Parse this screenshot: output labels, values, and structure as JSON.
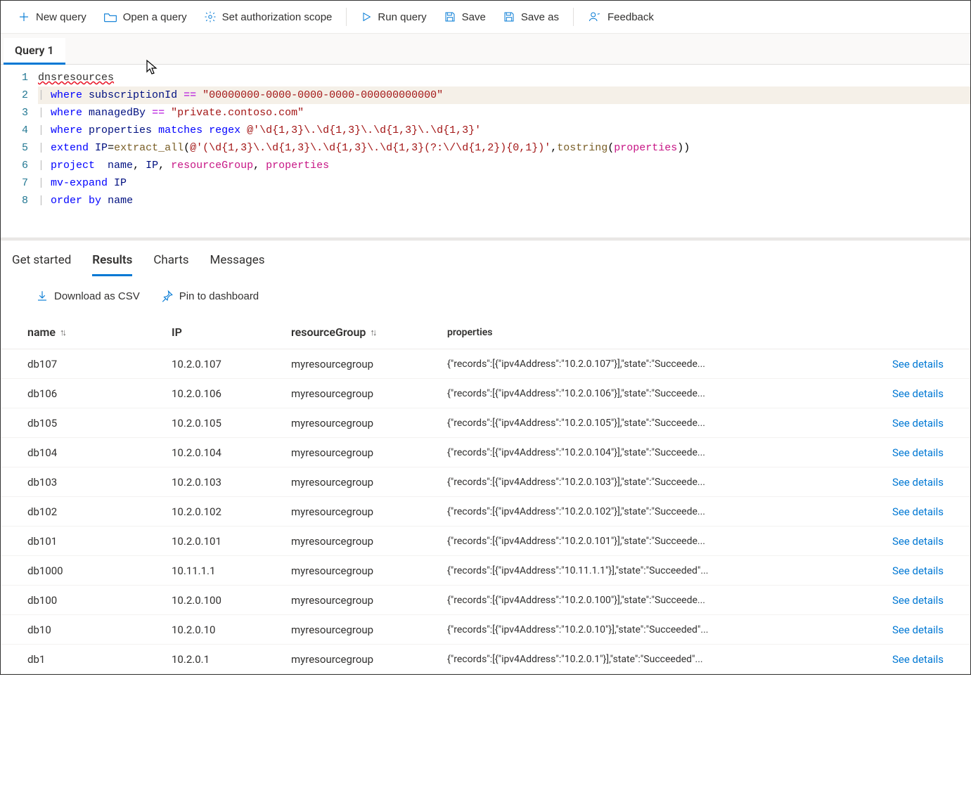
{
  "toolbar": {
    "new_query": "New query",
    "open_query": "Open a query",
    "set_scope": "Set authorization scope",
    "run_query": "Run query",
    "save": "Save",
    "save_as": "Save as",
    "feedback": "Feedback"
  },
  "tabs": {
    "active": "Query 1"
  },
  "editor": {
    "lines": [
      {
        "n": 1,
        "tokens": [
          {
            "t": "table",
            "v": "dnsresources"
          }
        ]
      },
      {
        "n": 2,
        "hl": true,
        "tokens": [
          {
            "t": "pipe",
            "v": "| "
          },
          {
            "t": "kw",
            "v": "where "
          },
          {
            "t": "col",
            "v": "subscriptionId "
          },
          {
            "t": "op",
            "v": "== "
          },
          {
            "t": "str",
            "v": "\"00000000-0000-0000-0000-000000000000\""
          }
        ]
      },
      {
        "n": 3,
        "tokens": [
          {
            "t": "pipe",
            "v": "| "
          },
          {
            "t": "kw",
            "v": "where "
          },
          {
            "t": "col",
            "v": "managedBy "
          },
          {
            "t": "op",
            "v": "== "
          },
          {
            "t": "str",
            "v": "\"private.contoso.com\""
          }
        ]
      },
      {
        "n": 4,
        "tokens": [
          {
            "t": "pipe",
            "v": "| "
          },
          {
            "t": "kw",
            "v": "where "
          },
          {
            "t": "col",
            "v": "properties "
          },
          {
            "t": "kw",
            "v": "matches regex "
          },
          {
            "t": "re",
            "v": "@'\\d{1,3}\\.\\d{1,3}\\.\\d{1,3}\\.\\d{1,3}'"
          }
        ]
      },
      {
        "n": 5,
        "tokens": [
          {
            "t": "pipe",
            "v": "| "
          },
          {
            "t": "kw",
            "v": "extend "
          },
          {
            "t": "col",
            "v": "IP"
          },
          {
            "t": "punc",
            "v": "="
          },
          {
            "t": "func",
            "v": "extract_all"
          },
          {
            "t": "punc",
            "v": "("
          },
          {
            "t": "re",
            "v": "@'(\\d{1,3}\\.\\d{1,3}\\.\\d{1,3}\\.\\d{1,3}(?:\\/\\d{1,2}){0,1})'"
          },
          {
            "t": "punc",
            "v": ","
          },
          {
            "t": "func",
            "v": "tostring"
          },
          {
            "t": "punc",
            "v": "("
          },
          {
            "t": "col2",
            "v": "properties"
          },
          {
            "t": "punc",
            "v": "))"
          }
        ]
      },
      {
        "n": 6,
        "tokens": [
          {
            "t": "pipe",
            "v": "| "
          },
          {
            "t": "kw",
            "v": "project  "
          },
          {
            "t": "col",
            "v": "name"
          },
          {
            "t": "punc",
            "v": ", "
          },
          {
            "t": "col",
            "v": "IP"
          },
          {
            "t": "punc",
            "v": ", "
          },
          {
            "t": "col2",
            "v": "resourceGroup"
          },
          {
            "t": "punc",
            "v": ", "
          },
          {
            "t": "col2",
            "v": "properties"
          }
        ]
      },
      {
        "n": 7,
        "tokens": [
          {
            "t": "pipe",
            "v": "| "
          },
          {
            "t": "kw",
            "v": "mv-expand "
          },
          {
            "t": "col",
            "v": "IP"
          }
        ]
      },
      {
        "n": 8,
        "tokens": [
          {
            "t": "pipe",
            "v": "| "
          },
          {
            "t": "kw",
            "v": "order "
          },
          {
            "t": "opblk",
            "v": "by "
          },
          {
            "t": "col",
            "v": "name"
          }
        ]
      }
    ]
  },
  "result_tabs": {
    "get_started": "Get started",
    "results": "Results",
    "charts": "Charts",
    "messages": "Messages"
  },
  "result_actions": {
    "download_csv": "Download as CSV",
    "pin_dashboard": "Pin to dashboard"
  },
  "table": {
    "headers": {
      "name": "name",
      "ip": "IP",
      "rg": "resourceGroup",
      "props": "properties"
    },
    "see_details": "See details",
    "rows": [
      {
        "name": "db107",
        "ip": "10.2.0.107",
        "rg": "myresourcegroup",
        "props": "{\"records\":[{\"ipv4Address\":\"10.2.0.107\"}],\"state\":\"Succeede..."
      },
      {
        "name": "db106",
        "ip": "10.2.0.106",
        "rg": "myresourcegroup",
        "props": "{\"records\":[{\"ipv4Address\":\"10.2.0.106\"}],\"state\":\"Succeede..."
      },
      {
        "name": "db105",
        "ip": "10.2.0.105",
        "rg": "myresourcegroup",
        "props": "{\"records\":[{\"ipv4Address\":\"10.2.0.105\"}],\"state\":\"Succeede..."
      },
      {
        "name": "db104",
        "ip": "10.2.0.104",
        "rg": "myresourcegroup",
        "props": "{\"records\":[{\"ipv4Address\":\"10.2.0.104\"}],\"state\":\"Succeede..."
      },
      {
        "name": "db103",
        "ip": "10.2.0.103",
        "rg": "myresourcegroup",
        "props": "{\"records\":[{\"ipv4Address\":\"10.2.0.103\"}],\"state\":\"Succeede..."
      },
      {
        "name": "db102",
        "ip": "10.2.0.102",
        "rg": "myresourcegroup",
        "props": "{\"records\":[{\"ipv4Address\":\"10.2.0.102\"}],\"state\":\"Succeede..."
      },
      {
        "name": "db101",
        "ip": "10.2.0.101",
        "rg": "myresourcegroup",
        "props": "{\"records\":[{\"ipv4Address\":\"10.2.0.101\"}],\"state\":\"Succeede..."
      },
      {
        "name": "db1000",
        "ip": "10.11.1.1",
        "rg": "myresourcegroup",
        "props": "{\"records\":[{\"ipv4Address\":\"10.11.1.1\"}],\"state\":\"Succeeded\"..."
      },
      {
        "name": "db100",
        "ip": "10.2.0.100",
        "rg": "myresourcegroup",
        "props": "{\"records\":[{\"ipv4Address\":\"10.2.0.100\"}],\"state\":\"Succeede..."
      },
      {
        "name": "db10",
        "ip": "10.2.0.10",
        "rg": "myresourcegroup",
        "props": "{\"records\":[{\"ipv4Address\":\"10.2.0.10\"}],\"state\":\"Succeeded\"..."
      },
      {
        "name": "db1",
        "ip": "10.2.0.1",
        "rg": "myresourcegroup",
        "props": "{\"records\":[{\"ipv4Address\":\"10.2.0.1\"}],\"state\":\"Succeeded\"..."
      }
    ]
  }
}
